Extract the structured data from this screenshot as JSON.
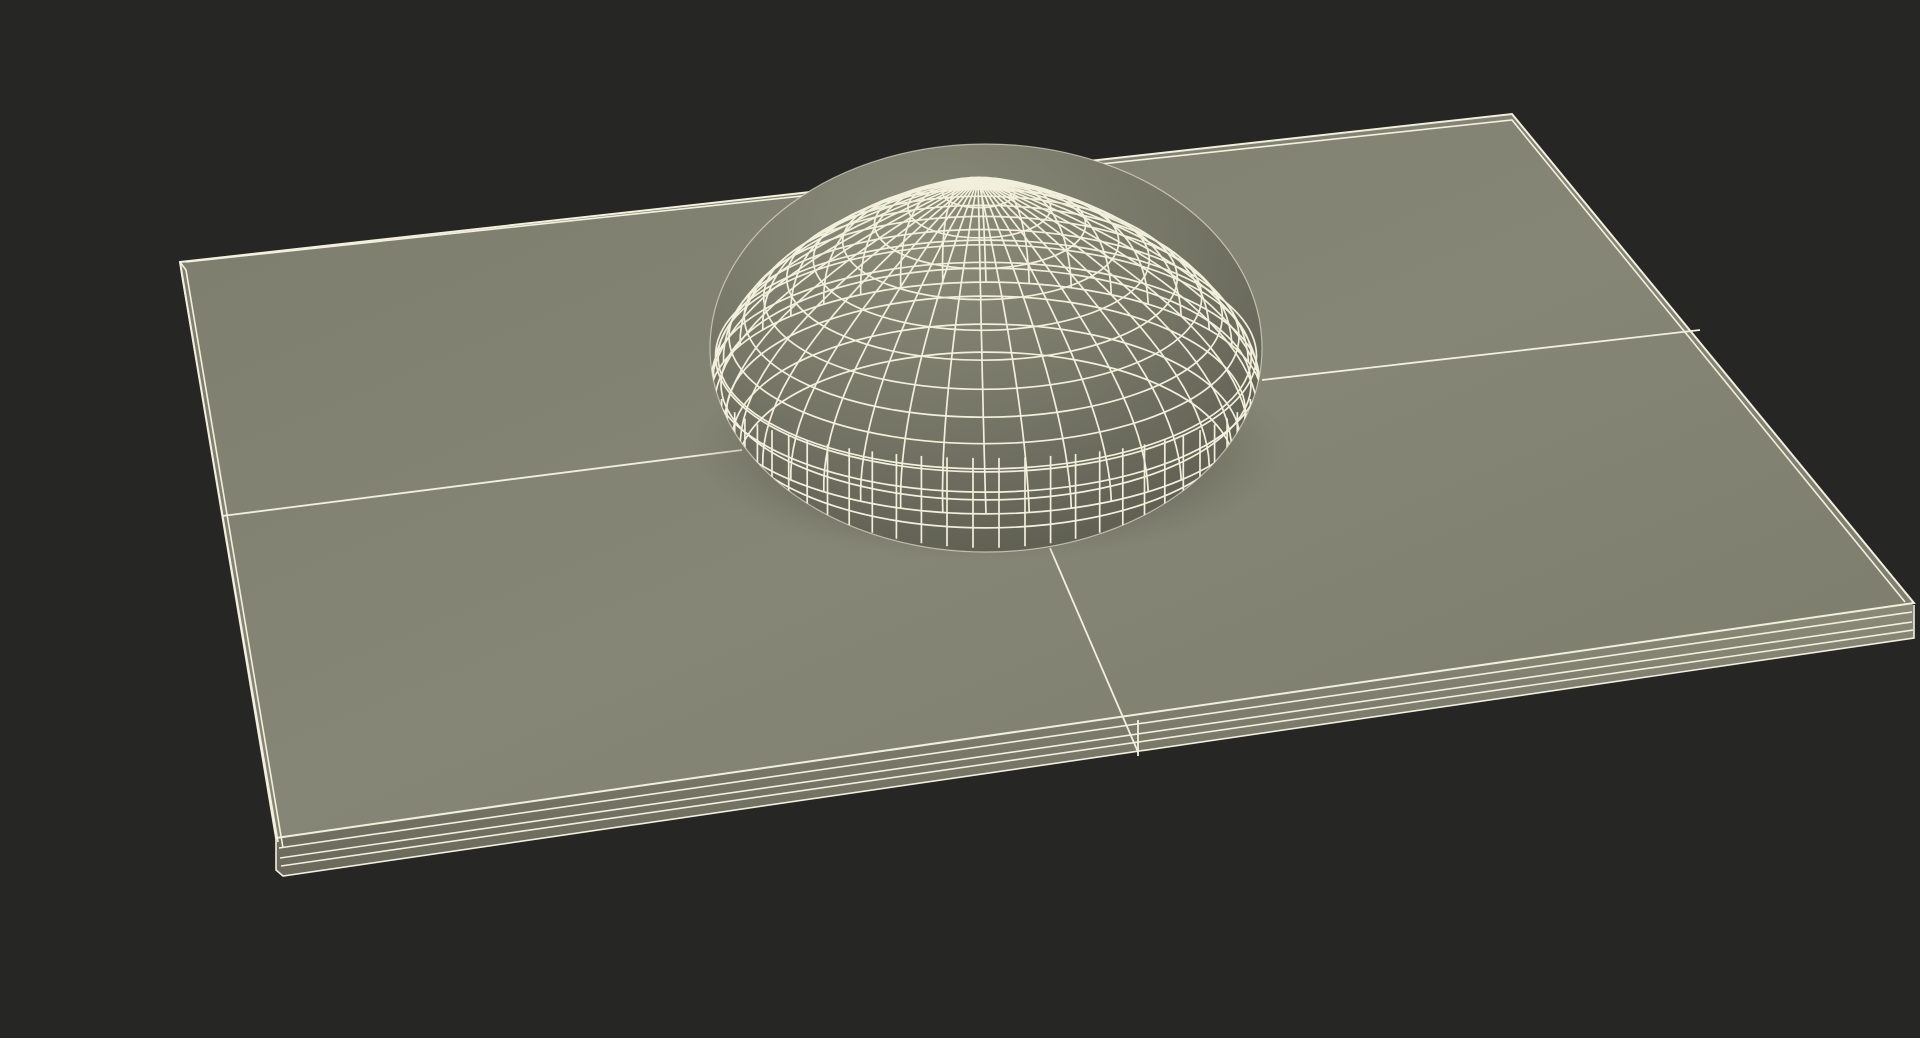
{
  "scene": {
    "background_color": "#262624",
    "surface_color": "#858574",
    "wire_color": "#f2efdc",
    "objects": [
      {
        "name": "base-slab",
        "type": "rounded-rectangular-plate",
        "subdivisions": "2x2"
      },
      {
        "name": "dome",
        "type": "flattened-spheroid",
        "display": "wireframe-on-shaded"
      }
    ]
  }
}
